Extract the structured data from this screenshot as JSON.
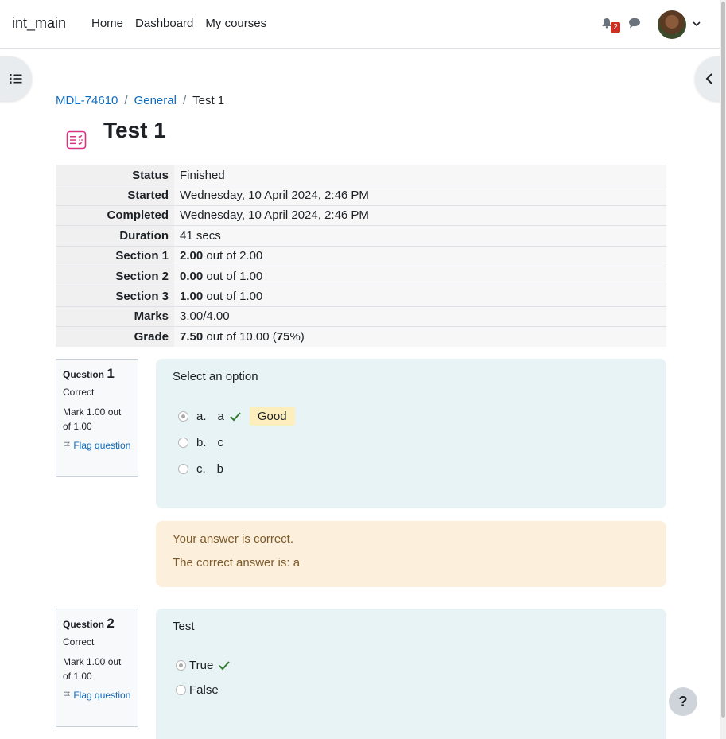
{
  "nav": {
    "brand": "int_main",
    "links": [
      "Home",
      "Dashboard",
      "My courses"
    ],
    "notification_count": "2"
  },
  "breadcrumb": [
    "MDL-74610",
    "General",
    "Test 1"
  ],
  "page_title": "Test 1",
  "summary": [
    {
      "label": "Status",
      "value": "Finished"
    },
    {
      "label": "Started",
      "value": "Wednesday, 10 April 2024, 2:46 PM"
    },
    {
      "label": "Completed",
      "value": "Wednesday, 10 April 2024, 2:46 PM"
    },
    {
      "label": "Duration",
      "value": "41 secs"
    },
    {
      "label": "Section 1",
      "bold": "2.00",
      "rest": " out of 2.00"
    },
    {
      "label": "Section 2",
      "bold": "0.00",
      "rest": " out of 1.00"
    },
    {
      "label": "Section 3",
      "bold": "1.00",
      "rest": " out of 1.00"
    },
    {
      "label": "Marks",
      "value": "3.00/4.00"
    },
    {
      "label": "Grade",
      "bold": "7.50",
      "rest": " out of 10.00 (",
      "bold2": "75",
      "rest2": "%)"
    }
  ],
  "questions": [
    {
      "label": "Question",
      "number": "1",
      "state": "Correct",
      "mark": "Mark 1.00 out of 1.00",
      "flag": "Flag question",
      "prompt": "Select an option",
      "options": [
        {
          "letter": "a.",
          "text": "a",
          "checked": true,
          "correct": true,
          "feedback": "Good"
        },
        {
          "letter": "b.",
          "text": "c"
        },
        {
          "letter": "c.",
          "text": "b"
        }
      ],
      "feedback_correct": "Your answer is correct.",
      "feedback_right_answer": "The correct answer is: a"
    },
    {
      "label": "Question",
      "number": "2",
      "state": "Correct",
      "mark": "Mark 1.00 out of 1.00",
      "flag": "Flag question",
      "prompt": "Test",
      "options": [
        {
          "text": "True",
          "checked": true,
          "correct": true
        },
        {
          "text": "False"
        }
      ]
    }
  ],
  "help_label": "?",
  "colors": {
    "link": "#0f6cbf",
    "question_bg": "#e7f3f5",
    "feedback_bg": "#fcefdc",
    "correct": "#357a32",
    "quiz_icon": "#d63384"
  }
}
